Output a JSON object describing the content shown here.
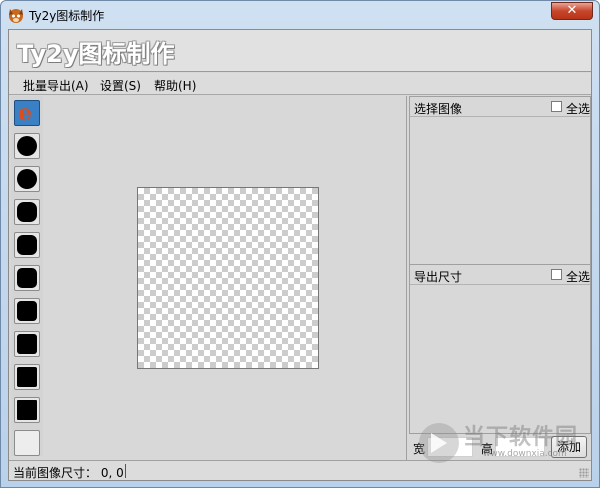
{
  "window": {
    "title": "Ty2y图标制作",
    "close_glyph": "✕",
    "icon": "app-fox-icon"
  },
  "banner": {
    "title": "Ty2y图标制作"
  },
  "menu": {
    "items": [
      {
        "label": "批量导出(A)"
      },
      {
        "label": "设置(S)"
      },
      {
        "label": "帮助(H)"
      }
    ]
  },
  "toolbar": {
    "tools": [
      {
        "icon": "ie-e-icon",
        "glyph": "e"
      },
      {
        "icon": "circle-icon"
      },
      {
        "icon": "circle-icon"
      },
      {
        "icon": "rounded-square-icon"
      },
      {
        "icon": "rounded-square-icon"
      },
      {
        "icon": "rounded-square-icon"
      },
      {
        "icon": "rounded-square-icon"
      },
      {
        "icon": "rounded-square-icon"
      },
      {
        "icon": "rounded-square-icon"
      },
      {
        "icon": "rounded-square-icon"
      },
      {
        "icon": "blank-icon"
      }
    ]
  },
  "select_panel": {
    "title": "选择图像",
    "select_all": "全选"
  },
  "export_panel": {
    "title": "导出尺寸",
    "select_all": "全选"
  },
  "size_inputs": {
    "width_label": "宽",
    "height_label": "高",
    "width_value": "",
    "height_value": "",
    "add_label": "添加"
  },
  "status": {
    "text": "当前图像尺寸：  0, 0"
  },
  "watermark": {
    "text": "当下软件园",
    "url": "www.downxia.com"
  }
}
